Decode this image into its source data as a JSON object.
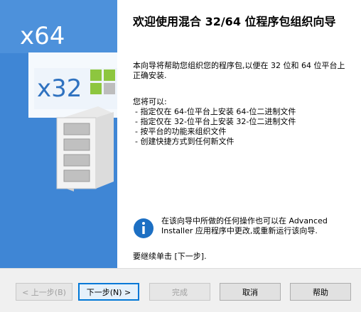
{
  "brand": {
    "x64_label": "x64",
    "x32_label": "x32",
    "colors": {
      "panel_blue": "#3f86d5",
      "tile_green": "#8dc63f",
      "info_blue": "#1c6fc3"
    }
  },
  "content": {
    "title": "欢迎使用混合 32/64 位程序包组织向导",
    "intro": "本向导将帮助您组织您的程序包,以便在 32 位和 64 位平台上正确安装.",
    "capabilities_title": "您将可以:",
    "capabilities": [
      " - 指定仅在 64-位平台上安装 64-位二进制文件",
      " - 指定仅在 32-位平台上安装 32-位二进制文件",
      " - 按平台的功能来组织文件",
      " - 创建快捷方式到任何新文件"
    ],
    "info_icon": "info-icon",
    "info_text": "在该向导中所做的任何操作也可以在 Advanced Installer 应用程序中更改,或重新运行该向导.",
    "continue_text": "要继续单击 [下一步]."
  },
  "footer": {
    "back_label": "< 上一步(B)",
    "next_label": "下一步(N) >",
    "finish_label": "完成",
    "cancel_label": "取消",
    "help_label": "帮助"
  }
}
